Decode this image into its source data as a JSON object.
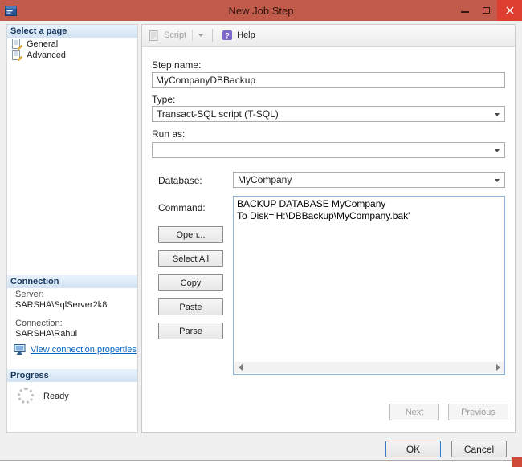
{
  "window": {
    "title": "New Job Step"
  },
  "toolbar": {
    "script": "Script",
    "help": "Help"
  },
  "sidebar": {
    "select_page_header": "Select a page",
    "pages": [
      {
        "label": "General"
      },
      {
        "label": "Advanced"
      }
    ],
    "connection": {
      "header": "Connection",
      "server_label": "Server:",
      "server_value": "SARSHA\\SqlServer2k8",
      "connection_label": "Connection:",
      "connection_value": "SARSHA\\Rahul",
      "link": "View connection properties"
    },
    "progress": {
      "header": "Progress",
      "status": "Ready"
    }
  },
  "form": {
    "step_name_label": "Step name:",
    "step_name_value": "MyCompanyDBBackup",
    "type_label": "Type:",
    "type_value": "Transact-SQL script (T-SQL)",
    "run_as_label": "Run as:",
    "run_as_value": "",
    "database_label": "Database:",
    "database_value": "MyCompany",
    "command_label": "Command:",
    "command_text": "BACKUP DATABASE MyCompany\nTo Disk='H:\\DBBackup\\MyCompany.bak'",
    "command_buttons": [
      {
        "label": "Open..."
      },
      {
        "label": "Select All"
      },
      {
        "label": "Copy"
      },
      {
        "label": "Paste"
      },
      {
        "label": "Parse"
      }
    ],
    "wizard": {
      "next": "Next",
      "previous": "Previous"
    }
  },
  "footer": {
    "ok": "OK",
    "cancel": "Cancel"
  },
  "colors": {
    "titlebar": "#C15B4C",
    "close_button": "#DE3F30",
    "section_header_text": "#17365D",
    "link": "#0563C1",
    "command_border": "#8AB6DB"
  }
}
